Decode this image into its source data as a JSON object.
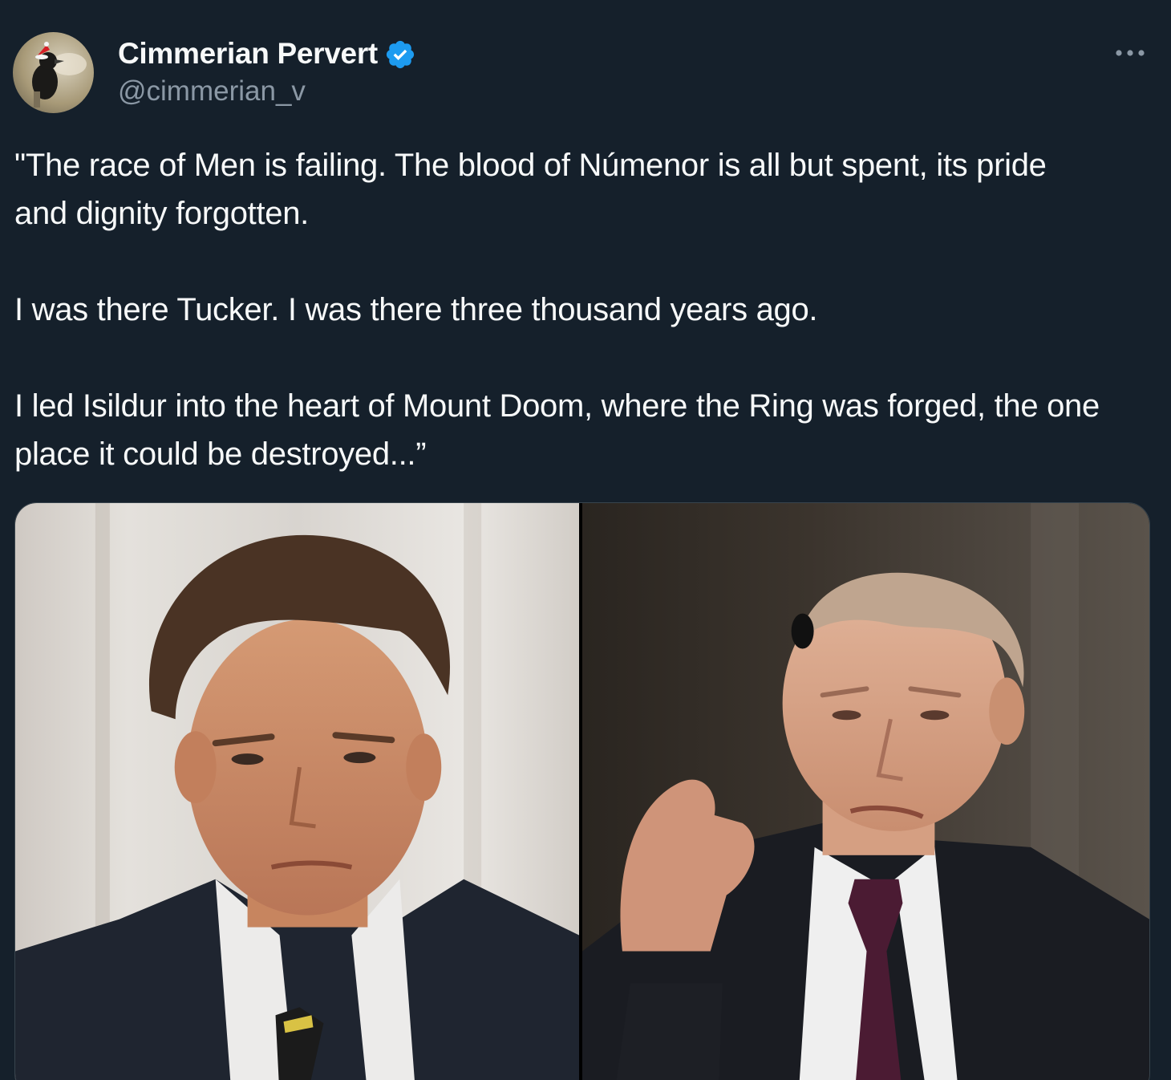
{
  "author": {
    "display_name": "Cimmerian Pervert",
    "handle": "@cimmerian_v",
    "verified": true,
    "avatar_icon": "raven-with-santa-hat-avatar"
  },
  "menu": {
    "more_icon": "more-horizontal-icon"
  },
  "tweet": {
    "lines": [
      "\"The race of Men is failing. The blood of Númenor is all but spent, its pride and dignity forgotten.",
      "I was there Tucker. I was there three thousand years ago.",
      "I led Isildur into the heart of Mount Doom, where the Ring was forged, the one place it could be destroyed...”"
    ]
  },
  "media": {
    "photos": [
      {
        "description_icon": "photo-left-man-in-suit"
      },
      {
        "description_icon": "photo-right-man-gesturing"
      }
    ]
  },
  "colors": {
    "background": "#15202b",
    "text_primary": "#f7f9f9",
    "text_secondary": "#8b98a5",
    "verified_blue": "#1d9bf0",
    "border": "#38444d"
  }
}
